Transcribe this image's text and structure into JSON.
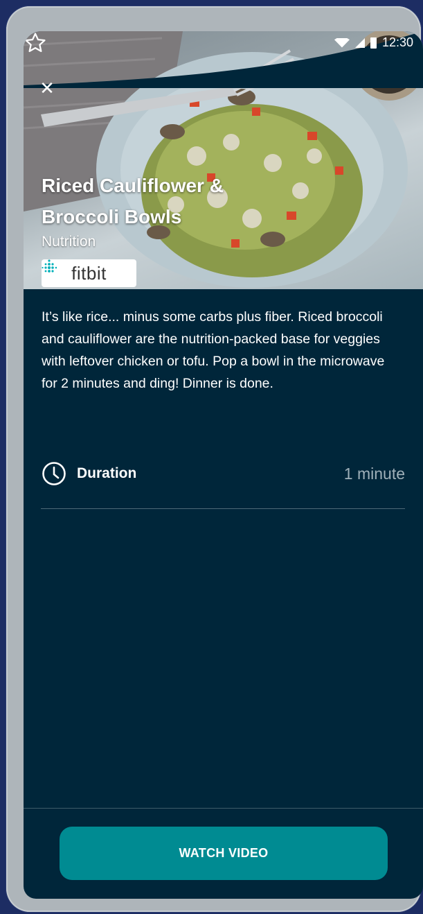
{
  "status_bar": {
    "time": "12:30"
  },
  "recipe": {
    "title": "Riced Cauliflower & Broccoli Bowls",
    "category": "Nutrition",
    "brand": "fitbit",
    "description": "It’s like rice... minus some carbs plus fiber. Riced broccoli and cauliflower are the nutrition-packed base for veggies with leftover chicken or tofu. Pop a bowl in the microwave for 2 minutes and ding! Dinner is done."
  },
  "duration": {
    "label": "Duration",
    "value": "1 minute"
  },
  "actions": {
    "watch_label": "WATCH VIDEO"
  },
  "icons": {
    "close": "close-icon",
    "favorite": "star-icon",
    "duration": "clock-icon",
    "brand": "fitbit-logo-icon"
  },
  "colors": {
    "background": "#00263a",
    "accent": "#008b92",
    "muted_text": "#9fb0b9"
  }
}
